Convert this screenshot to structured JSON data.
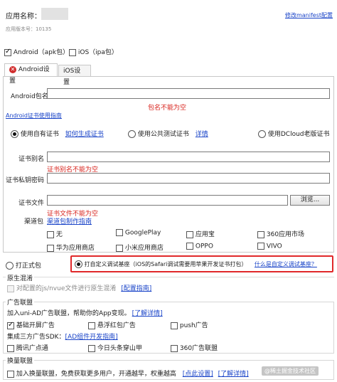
{
  "header": {
    "app_name_label": "应用名称：",
    "version_label": "应用版本号：",
    "version_value": "10135",
    "manifest_link": "修改manifest配置"
  },
  "platforms": {
    "android": {
      "label": "Android（apk包）",
      "checked": true
    },
    "ios": {
      "label": "iOS（ipa包）",
      "checked": false
    }
  },
  "tabs": [
    {
      "label": "Android设置",
      "active": true,
      "error": true
    },
    {
      "label": "iOS设置",
      "active": false
    }
  ],
  "android": {
    "package_label": "Android包名",
    "package_value": "",
    "package_error": "包名不能为空",
    "cert_guide_link": "Android证书使用指南",
    "cert_options": [
      {
        "label": "使用自有证书",
        "checked": true,
        "link": "如何生成证书"
      },
      {
        "label": "使用公共测试证书",
        "checked": false,
        "link": "详情"
      },
      {
        "label": "使用DCloud老版证书",
        "checked": false
      }
    ],
    "alias_label": "证书别名",
    "alias_error": "证书别名不能为空",
    "privkey_label": "证书私钥密码",
    "file_label": "证书文件",
    "file_error": "证书文件不能为空",
    "browse_button": "浏览...",
    "channel_label": "渠道包",
    "channel_link": "渠道包制作指南",
    "channels": [
      [
        "无",
        "GooglePlay",
        "应用宝",
        "360应用市场"
      ],
      [
        "华为应用商店",
        "小米应用商店",
        "OPPO",
        "VIVO"
      ]
    ]
  },
  "package_type": {
    "formal_label": "打正式包",
    "formal_checked": false,
    "custom_label": "打自定义调试基座（iOS的Safari调试需要用苹果开发证书打包）",
    "custom_checked": true,
    "custom_link": "什么是自定义调试基座？"
  },
  "obfuscation": {
    "title": "原生混淆",
    "option": "对配置的js/nvue文件进行原生混淆",
    "link": "[配置指南]"
  },
  "ads": {
    "title": "广告联盟",
    "intro": "加入uni-AD广告联盟，帮助你的App变现。",
    "intro_link": "[了解详情]",
    "row1": [
      {
        "label": "基础开屏广告",
        "checked": true
      },
      {
        "label": "悬浮红包广告",
        "checked": false
      },
      {
        "label": "push广告",
        "checked": false
      }
    ],
    "sdk_label": "集成三方广告SDK：",
    "sdk_link": "[AD组件开发指南]",
    "row2": [
      {
        "label": "腾讯广点通",
        "checked": false
      },
      {
        "label": "今日头条穿山甲",
        "checked": false
      },
      {
        "label": "360广告联盟",
        "checked": false
      }
    ]
  },
  "exchange": {
    "title": "换量联盟",
    "option": "加入换量联盟，免费获取更多用户，开通越早，权重越高",
    "link1": "[点此设置]",
    "link2": "[了解详情]"
  },
  "watermark": "@稀土掘金技术社区"
}
